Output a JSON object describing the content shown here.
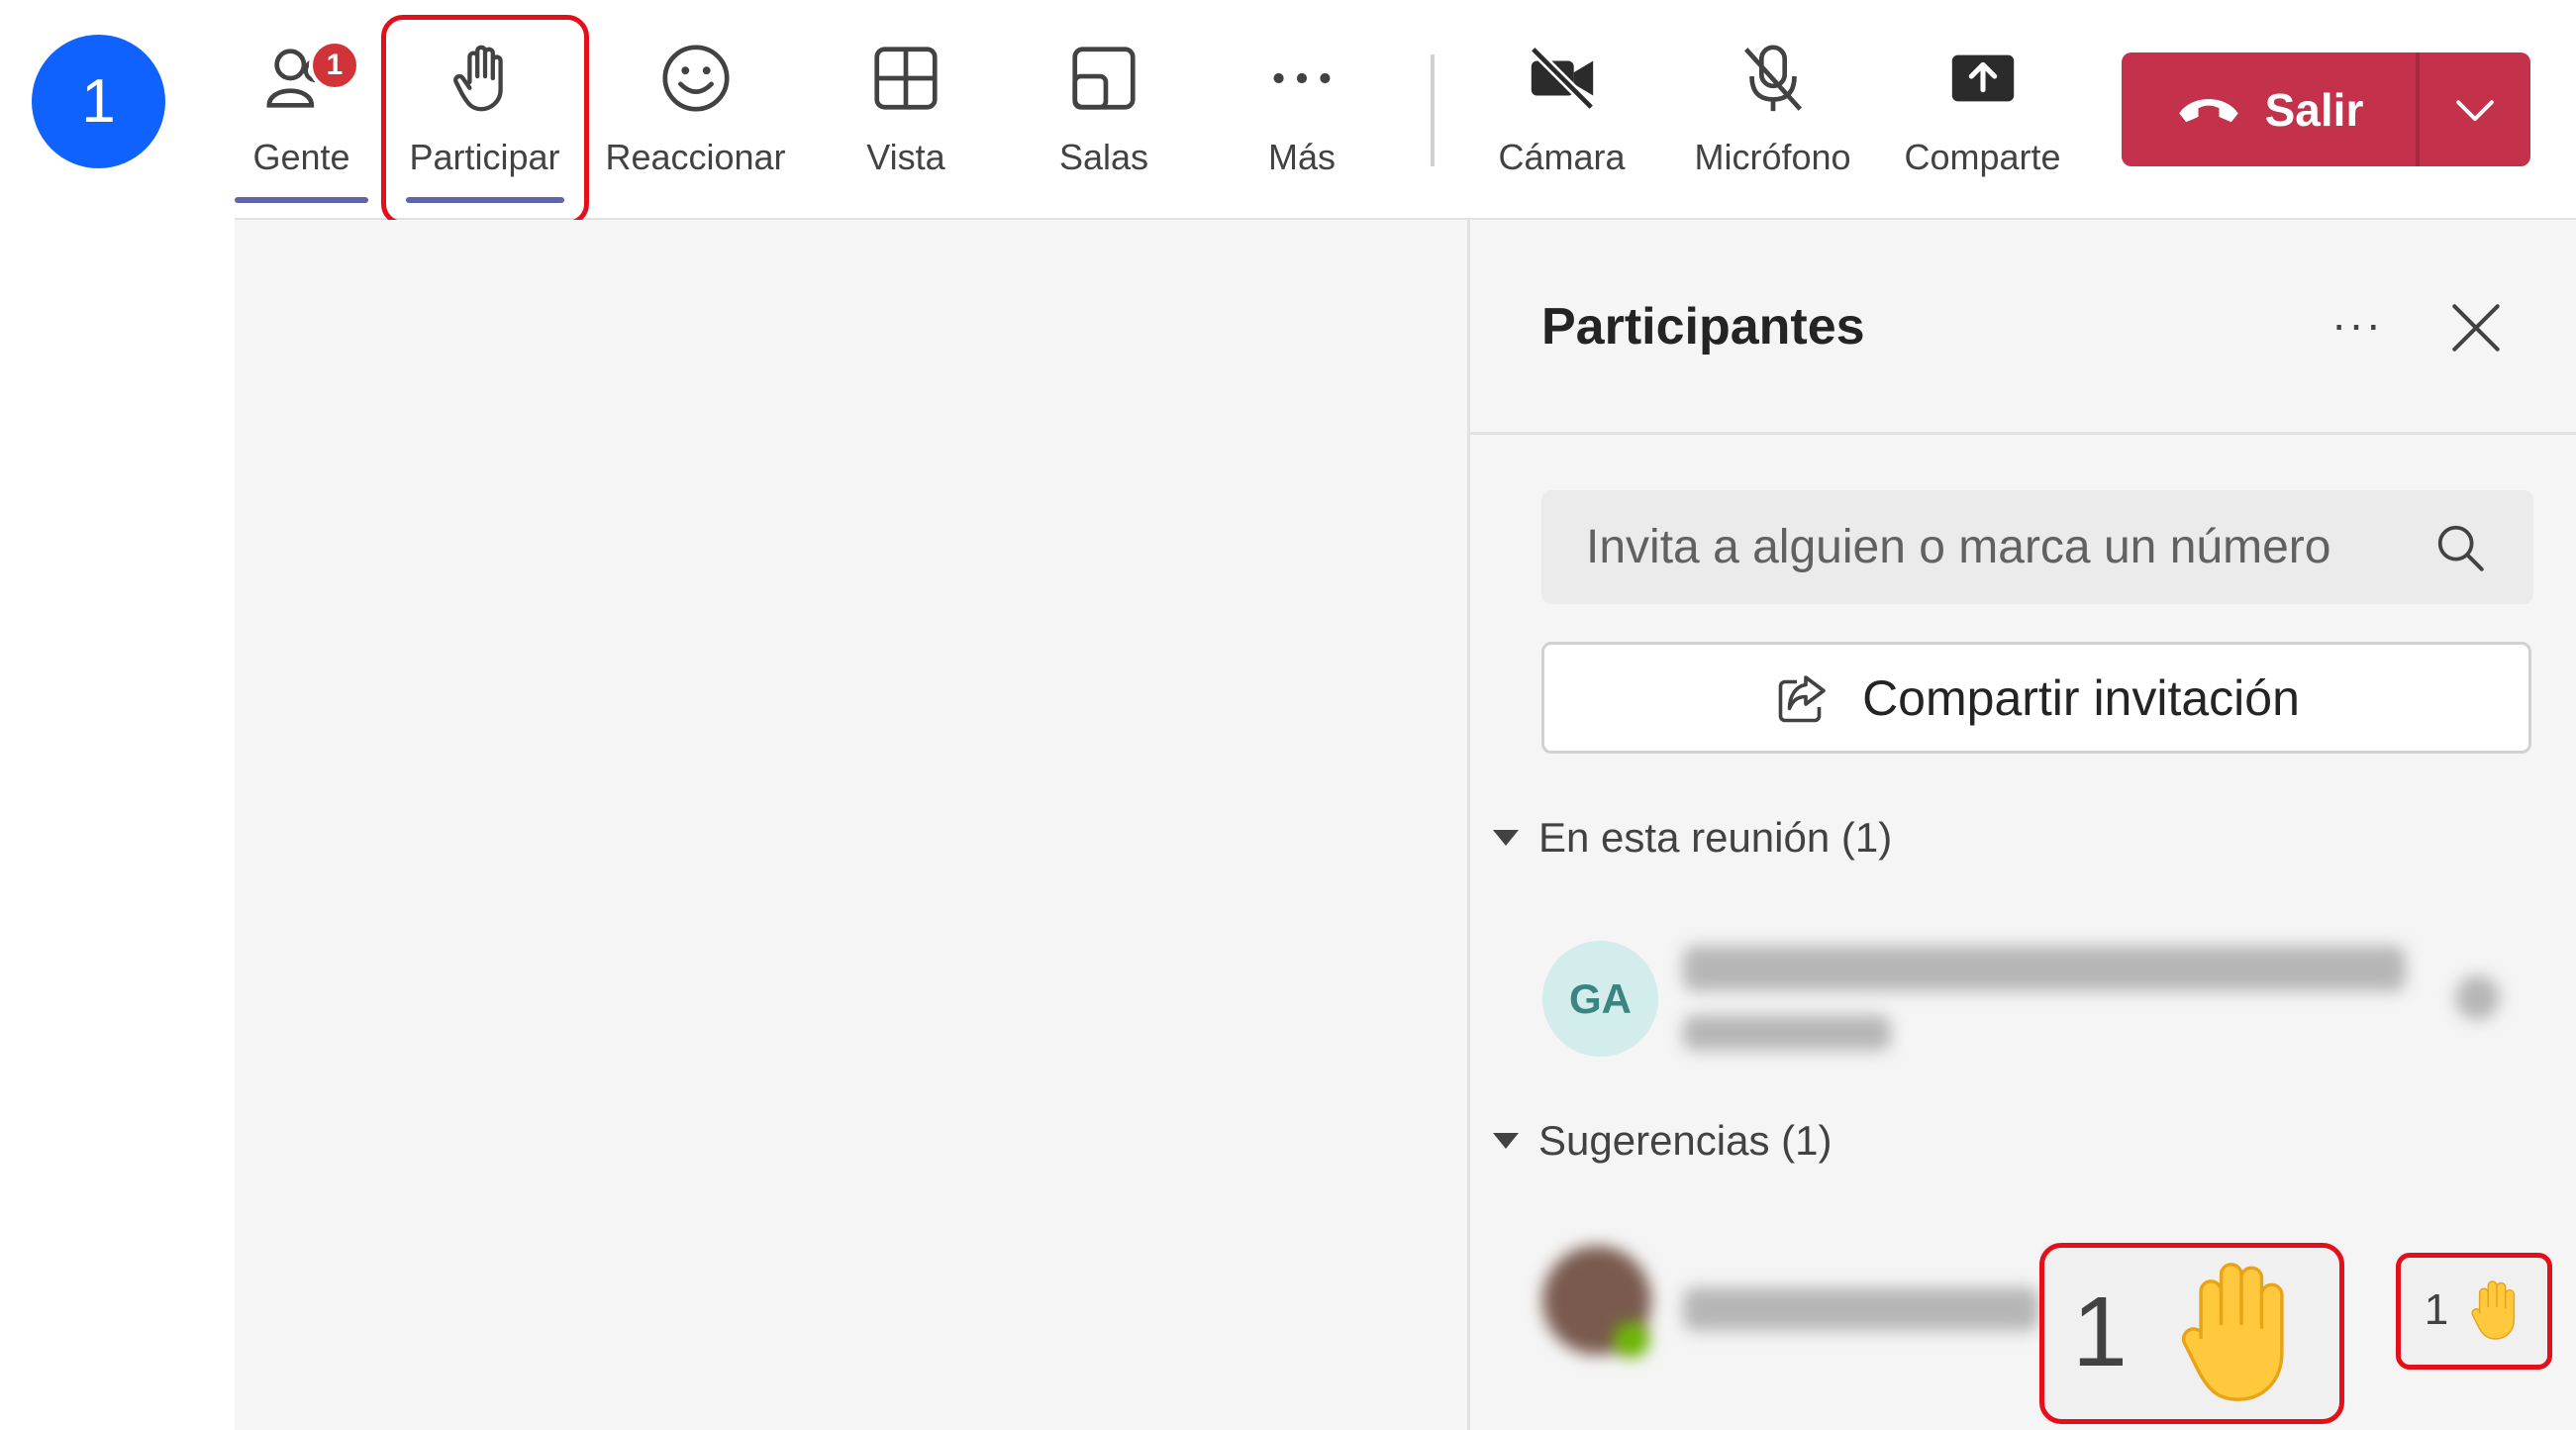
{
  "step_badge": "1",
  "toolbar": {
    "people": {
      "label": "Gente",
      "icon": "people-icon",
      "badge": "1"
    },
    "raise": {
      "label": "Participar",
      "icon": "raise-hand-icon"
    },
    "react": {
      "label": "Reaccionar",
      "icon": "smiley-icon"
    },
    "view": {
      "label": "Vista",
      "icon": "grid-view-icon"
    },
    "rooms": {
      "label": "Salas",
      "icon": "breakout-rooms-icon"
    },
    "more": {
      "label": "Más",
      "icon": "more-icon"
    },
    "camera": {
      "label": "Cámara",
      "icon": "camera-off-icon"
    },
    "mic": {
      "label": "Micrófono",
      "icon": "mic-off-icon"
    },
    "share": {
      "label": "Comparte",
      "icon": "share-tray-icon"
    },
    "leave": {
      "label": "Salir",
      "icon": "hang-up-icon"
    }
  },
  "panel": {
    "title": "Participantes",
    "more": "···",
    "search_placeholder": "Invita a alguien o marca un número",
    "share_label": "Compartir invitación",
    "section_in_meeting": "En esta reunión (1)",
    "participant_initials": "GA",
    "section_suggestions": "Sugerencias (1)"
  },
  "raised_hands": {
    "count_large": "1",
    "count_small": "1"
  },
  "colors": {
    "accent": "#6264a7",
    "leave": "#c4314b",
    "highlight": "#e3101c",
    "badge": "#d13438",
    "step": "#0f62fe"
  }
}
